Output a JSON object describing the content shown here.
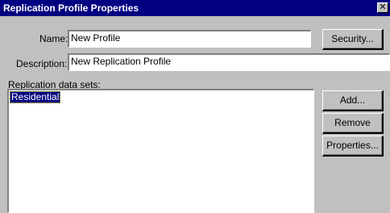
{
  "window": {
    "title": "Replication Profile Properties",
    "close_glyph": "✕"
  },
  "form": {
    "name_label": "Name:",
    "name_value": "New Profile",
    "description_label": "Description:",
    "description_value": "New Replication Profile",
    "datasets_label": "Replication data sets:"
  },
  "datasets": {
    "items": [
      "Residential"
    ],
    "selected": "Residential"
  },
  "buttons": {
    "security": "Security...",
    "add": "Add...",
    "remove": "Remove",
    "properties": "Properties..."
  }
}
